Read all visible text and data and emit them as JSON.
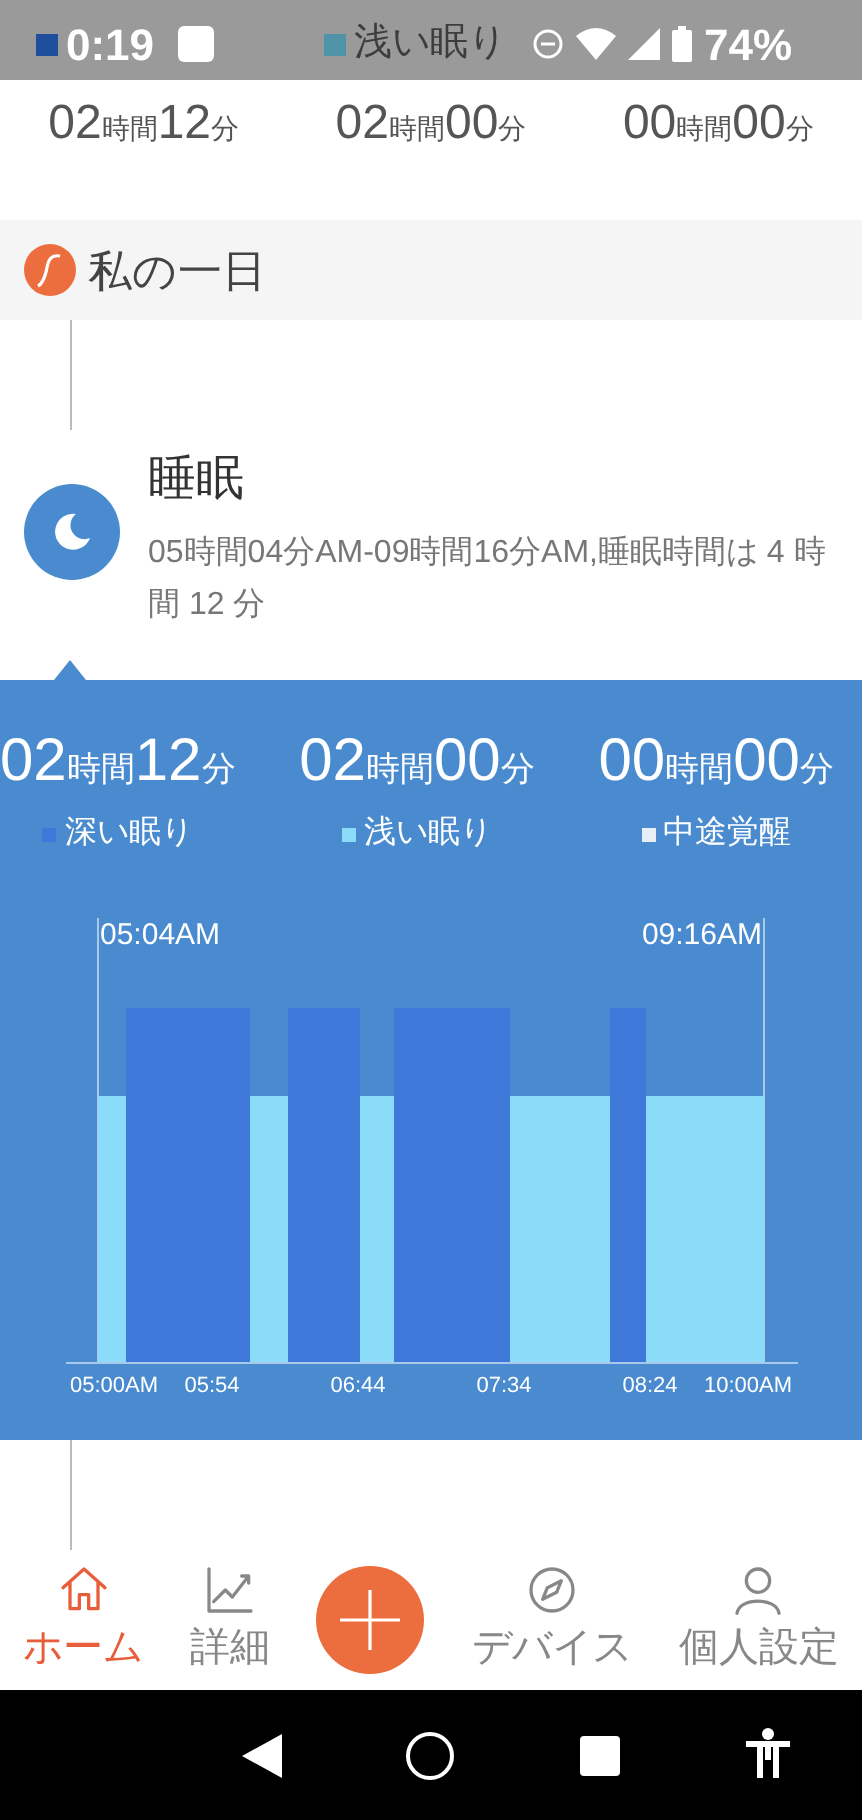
{
  "status_bar": {
    "time": "0:19",
    "battery": "74%"
  },
  "top_summary": [
    {
      "color": "#1f4e9c",
      "hours": "02",
      "hours_unit": "時間",
      "minutes": "12",
      "minutes_unit": "分"
    },
    {
      "label": "浅い眠り",
      "color": "#4f93a8",
      "hours": "02",
      "hours_unit": "時間",
      "minutes": "00",
      "minutes_unit": "分"
    },
    {
      "hours": "00",
      "hours_unit": "時間",
      "minutes": "00",
      "minutes_unit": "分"
    }
  ],
  "section": {
    "title": "私の一日"
  },
  "entry": {
    "title": "睡眠",
    "description": "05時間04分AM-09時間16分AM,睡眠時間は 4 時間 12 分"
  },
  "panel": {
    "stats": [
      {
        "label": "深い眠り",
        "color": "#3e78d8",
        "hours": "02",
        "hours_unit": "時間",
        "minutes": "12",
        "minutes_unit": "分"
      },
      {
        "label": "浅い眠り",
        "color": "#8adcf8",
        "hours": "02",
        "hours_unit": "時間",
        "minutes": "00",
        "minutes_unit": "分"
      },
      {
        "label": "中途覚醒",
        "color": "#e8eef8",
        "hours": "00",
        "hours_unit": "時間",
        "minutes": "00",
        "minutes_unit": "分"
      }
    ],
    "start_label": "05:04AM",
    "end_label": "09:16AM",
    "x_ticks": [
      "05:00AM",
      "05:54",
      "06:44",
      "07:34",
      "08:24",
      "10:00AM"
    ]
  },
  "bottom_nav": [
    {
      "label": "ホーム",
      "kind": "home",
      "selected": true
    },
    {
      "label": "詳細",
      "kind": "chart",
      "selected": false
    },
    {
      "kind": "add"
    },
    {
      "label": "デバイス",
      "kind": "compass",
      "selected": false
    },
    {
      "label": "個人設定",
      "kind": "person",
      "selected": false
    }
  ]
}
